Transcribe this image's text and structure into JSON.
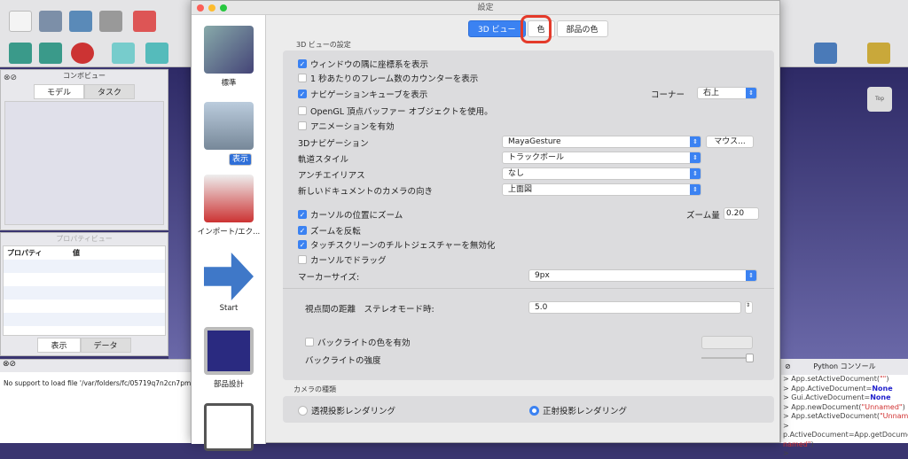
{
  "dialog": {
    "title": "設定",
    "tabs": [
      "3D ビュー",
      "色",
      "部品の色"
    ]
  },
  "sidebar": [
    {
      "label": "標準",
      "icon": "wrench-screwdriver-icon"
    },
    {
      "label": "表示",
      "icon": "monitor-icon",
      "selected": true
    },
    {
      "label": "インポート/エク...",
      "icon": "import-export-icon"
    },
    {
      "label": "Start",
      "icon": "arrow-right-icon"
    },
    {
      "label": "部品設計",
      "icon": "part-design-icon"
    }
  ],
  "settings": {
    "group_label": "3D ビューの設定",
    "checks": [
      {
        "label": "ウィンドウの隅に座標系を表示",
        "checked": true
      },
      {
        "label": "1 秒あたりのフレーム数のカウンターを表示",
        "checked": false
      },
      {
        "label": "ナビゲーションキューブを表示",
        "checked": true
      },
      {
        "label": "OpenGL 頂点バッファー オブジェクトを使用。",
        "checked": false
      },
      {
        "label": "アニメーションを有効",
        "checked": false
      }
    ],
    "corner_label": "コーナー",
    "corner_value": "右上",
    "nav_label": "3Dナビゲーション",
    "nav_value": "MayaGesture",
    "mouse_button": "マウス...",
    "orbit_label": "軌道スタイル",
    "orbit_value": "トラックボール",
    "aa_label": "アンチエイリアス",
    "aa_value": "なし",
    "cam_label": "新しいドキュメントのカメラの向き",
    "cam_value": "上面図",
    "zoom_cursor": {
      "label": "カーソルの位置にズーム",
      "checked": true
    },
    "zoom_step_label": "ズーム量",
    "zoom_step": "0.20",
    "checks2": [
      {
        "label": "ズームを反転",
        "checked": true
      },
      {
        "label": "タッチスクリーンのチルトジェスチャーを無効化",
        "checked": true
      },
      {
        "label": "カーソルでドラッグ",
        "checked": false
      }
    ],
    "marker_label": "マーカーサイズ:",
    "marker_value": "9px",
    "eye_label": "視点間の距離　ステレオモード時:",
    "eye_value": "5.0",
    "backlight": {
      "label": "バックライトの色を有効",
      "checked": false
    },
    "backlight_intensity_label": "バックライトの強度",
    "backlight_intensity": 1.0,
    "camera_group_label": "カメラの種類",
    "camera_options": [
      {
        "label": "透視投影レンダリング",
        "selected": false
      },
      {
        "label": "正射投影レンダリング",
        "selected": true
      }
    ]
  },
  "combo": {
    "title": "コンボビュー",
    "tabs": [
      "モデル",
      "タスク"
    ]
  },
  "property": {
    "title": "プロパティビュー",
    "col1": "プロパティ",
    "col2": "値",
    "tabs": [
      "表示",
      "データ"
    ]
  },
  "report": {
    "text": "No support to load file '/var/folders/fc/05719q7n2cn7pm156v"
  },
  "console": {
    "title": "Python コンソール",
    "lines": [
      [
        "> App.setActiveDocument(",
        "\"\"",
        ")"
      ],
      [
        "> App.ActiveDocument=",
        "None",
        ""
      ],
      [
        "> Gui.ActiveDocument=",
        "None",
        ""
      ],
      [
        "> App.newDocument(",
        "\"Unnamed\"",
        ")"
      ],
      [
        "> App.setActiveDocument(",
        "\"Unnamed\"",
        ")"
      ],
      [
        ">",
        "",
        ""
      ],
      [
        "p.ActiveDocument=App.getDocument(",
        "\"",
        ""
      ],
      [
        "",
        "named\"",
        ")"
      ],
      [
        ">",
        "",
        ""
      ]
    ]
  },
  "navcube": {
    "label": "Top"
  },
  "colors": {
    "accent": "#3b82f2",
    "highlight": "#e43a2a"
  }
}
